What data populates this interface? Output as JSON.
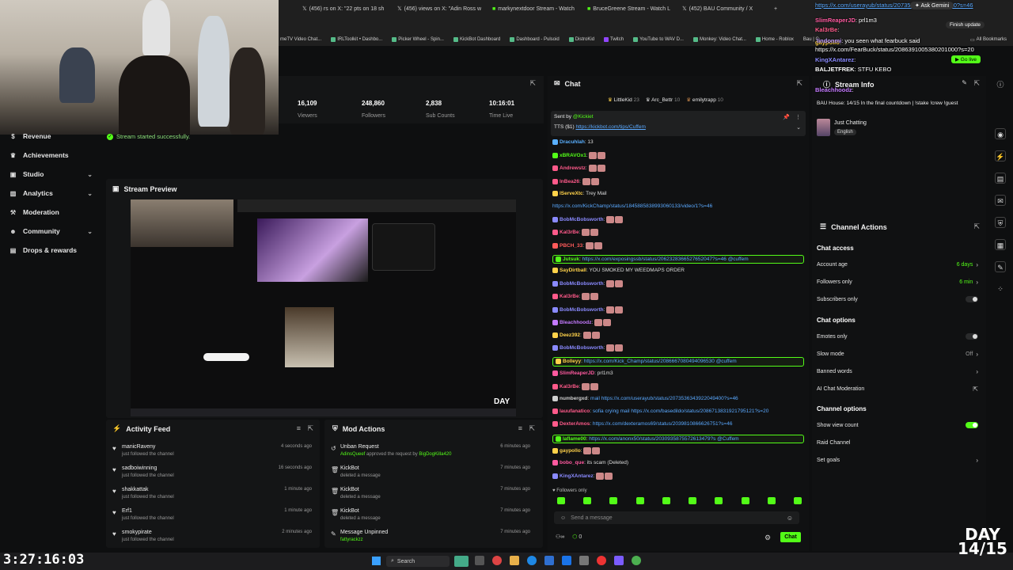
{
  "browser": {
    "tabs": [
      {
        "label": "(456) rs on X: \"22 pts on 18 sh"
      },
      {
        "label": "(456) views on X: \"Adin Ross w"
      },
      {
        "label": "markynextdoor Stream - Watch"
      },
      {
        "label": "BruceGreene Stream - Watch L"
      },
      {
        "label": "(452) BAU Community / X"
      }
    ],
    "ask_gemini": "Ask Gemini",
    "finish_update": "Finish update",
    "bookmarks": [
      "meTV Video Chat...",
      "IRLToolkit • Dashbo...",
      "Picker Wheel - Spin...",
      "KickBot Dashboard",
      "Dashboard - Pulsoid",
      "DistroKid",
      "Twitch",
      "YouTube to WAV D...",
      "Monkey: Video Chat...",
      "Home - Roblox",
      "Bau | C",
      "All Bookmarks"
    ]
  },
  "sidebar": {
    "items": [
      {
        "label": "Revenue",
        "icon": "dollar-icon",
        "chevron": false
      },
      {
        "label": "Achievements",
        "icon": "trophy-icon",
        "chevron": false
      },
      {
        "label": "Studio",
        "icon": "studio-icon",
        "chevron": true
      },
      {
        "label": "Analytics",
        "icon": "chart-icon",
        "chevron": true
      },
      {
        "label": "Moderation",
        "icon": "hammer-icon",
        "chevron": false
      },
      {
        "label": "Community",
        "icon": "people-icon",
        "chevron": true
      },
      {
        "label": "Drops & rewards",
        "icon": "gift-icon",
        "chevron": false
      }
    ]
  },
  "stats": [
    {
      "value": "16,109",
      "label": "Viewers"
    },
    {
      "value": "248,860",
      "label": "Followers"
    },
    {
      "value": "2,838",
      "label": "Sub Counts"
    },
    {
      "value": "10:16:01",
      "label": "Time Live"
    }
  ],
  "status": {
    "success": "Stream started successfully."
  },
  "preview": {
    "title": "Stream Preview",
    "day_badge": "DAY"
  },
  "activity": {
    "title": "Activity Feed",
    "items": [
      {
        "name": "manicRaveny",
        "sub": "just followed the channel",
        "time": "4 seconds ago"
      },
      {
        "name": "sadboiwinning",
        "sub": "just followed the channel",
        "time": "16 seconds ago"
      },
      {
        "name": "shakkattak",
        "sub": "just followed the channel",
        "time": "1 minute ago"
      },
      {
        "name": "Erf1",
        "sub": "just followed the channel",
        "time": "1 minute ago"
      },
      {
        "name": "smokypirate",
        "sub": "just followed the channel",
        "time": "2 minutes ago"
      }
    ]
  },
  "mod": {
    "title": "Mod Actions",
    "items": [
      {
        "name": "Unban Request",
        "sub_user": "AdinsQueef",
        "sub": "approved the request by",
        "sub_user2": "BigDogKilla420",
        "time": "6 minutes ago"
      },
      {
        "name": "KickBot",
        "sub": "deleted a message",
        "time": "7 minutes ago"
      },
      {
        "name": "KickBot",
        "sub": "deleted a message",
        "time": "7 minutes ago"
      },
      {
        "name": "KickBot",
        "sub": "deleted a message",
        "time": "7 minutes ago"
      },
      {
        "name": "Message Unpinned",
        "sub": "fattyrackzz",
        "time": "7 minutes ago"
      }
    ]
  },
  "chat": {
    "title": "Chat",
    "top_gifters": [
      {
        "name": "LittleKid",
        "count": "23"
      },
      {
        "name": "Arc_Bettr",
        "count": "10"
      },
      {
        "name": "emilytrapp",
        "count": "10"
      }
    ],
    "pinned": {
      "sent_by_label": "Sent by",
      "sent_by_user": "@Kickiet",
      "text": "TTS ($1)",
      "link": "https://kickbot.com/tips/Cuffem"
    },
    "messages": [
      {
        "user": "Dracuhlah",
        "color": "#5ab0ff",
        "text": "13"
      },
      {
        "user": "xBRAVOx1",
        "color": "#53fc18",
        "text": ""
      },
      {
        "user": "Andrewstz",
        "color": "#ff5a8a",
        "text": ""
      },
      {
        "user": "lnBea26",
        "color": "#ff5a8a",
        "text": ""
      },
      {
        "user": "lServeXtc",
        "color": "#ffd24a",
        "text": "Trey Mail"
      },
      {
        "user": "",
        "color": "#5aa9ff",
        "text": "https://x.com/KickChamp/status/1845885838993060133/video/1?s=46"
      },
      {
        "user": "BobMcBobsworth",
        "color": "#8a8aff",
        "text": ""
      },
      {
        "user": "Kal3rBe",
        "color": "#ff5a8a",
        "text": ""
      },
      {
        "user": "PBCH_33",
        "color": "#ff5a5a",
        "text": ""
      },
      {
        "user": "Jutsuk",
        "color": "#53fc18",
        "text": "https://x.com/exposingssb/status/2062328366527652047?s=46 @cuffem"
      },
      {
        "user": "SayDirtball",
        "color": "#ffd24a",
        "text": "YOU SMOKED MY WEEDMAPS ORDER"
      },
      {
        "user": "BobMcBobsworth",
        "color": "#8a8aff",
        "text": ""
      },
      {
        "user": "Kal3rBe",
        "color": "#ff5a8a",
        "text": ""
      },
      {
        "user": "BobMcBobsworth",
        "color": "#8a8aff",
        "text": ""
      },
      {
        "user": "Bleachhoodz",
        "color": "#c47aff",
        "text": ""
      },
      {
        "user": "Deez392",
        "color": "#ffd24a",
        "text": ""
      },
      {
        "user": "BobMcBobsworth",
        "color": "#8a8aff",
        "text": ""
      },
      {
        "user": "Bolleyy",
        "color": "#ffd24a",
        "text": "https://x.com/Kick_Champ/status/2086667080494096530 @cuffem"
      },
      {
        "user": "SlimReaperJD",
        "color": "#ff5aa0",
        "text": "prl1m3"
      },
      {
        "user": "Kal3rBe",
        "color": "#ff5a8a",
        "text": ""
      },
      {
        "user": "numbergxd",
        "color": "#cfcfcf",
        "text": "mail https://x.com/userayub/status/2073536343922049400?s=46"
      },
      {
        "user": "lauufanatico",
        "color": "#ff5a8a",
        "text": "sofia crying mail https://x.com/basedildo/status/2086713831921795121?s=20"
      },
      {
        "user": "DexterAmos",
        "color": "#ff5a8a",
        "text": "https://x.com/dexteramos69/status/2039810866626751?s=46"
      },
      {
        "user": "laflame00",
        "color": "#53fc18",
        "text": "https://x.com/anonx50/status/2030935875572613479?s @Cuffem"
      },
      {
        "user": "gaypollo",
        "color": "#ffd24a",
        "text": ""
      },
      {
        "user": "bobo_que",
        "color": "#ff5aa0",
        "text": "its scam (Deleted)"
      },
      {
        "user": "KingXAntarez",
        "color": "#8a8aff",
        "text": ""
      }
    ],
    "followers_only": "Followers only",
    "input_placeholder": "Send a message",
    "send_label": "Chat",
    "points": "0"
  },
  "stream_info": {
    "title": "Stream Info",
    "stream_title": "BAU House: 14/15 In the final countdown | !stake !crew !guest",
    "category": "Just Chatting",
    "language": "English"
  },
  "channel_actions": {
    "title": "Channel Actions",
    "chat_access": "Chat access",
    "account_age": {
      "label": "Account age",
      "value": "6 days"
    },
    "followers_only": {
      "label": "Followers only",
      "value": "6 min"
    },
    "subscribers_only": {
      "label": "Subscribers only"
    },
    "chat_options": "Chat options",
    "emotes_only": {
      "label": "Emotes only"
    },
    "slow_mode": {
      "label": "Slow mode",
      "value": "Off"
    },
    "banned_words": {
      "label": "Banned words"
    },
    "ai_moderation": {
      "label": "AI Chat Moderation"
    },
    "channel_options": "Channel options",
    "show_viewer_count": {
      "label": "Show view count"
    },
    "raid_channel": {
      "label": "Raid Channel"
    },
    "set_goals": {
      "label": "Set goals"
    }
  },
  "overlay_chat": [
    {
      "user": "SlimReaperJD",
      "text": "prl1m3"
    },
    {
      "user": "Kal3rBe",
      "text": ""
    },
    {
      "user": "gaypollo",
      "text": ""
    },
    {
      "user": "lindonmi",
      "text": "you seen what fearbuck said"
    },
    {
      "user": "",
      "text": "https://x.com/FearBuck/status/2086391005380201000?s=20"
    },
    {
      "user": "KingXAntarez",
      "text": ""
    },
    {
      "user": "BALJETFREK",
      "text": "STFU KEBO"
    },
    {
      "user": "Bleachhoodz",
      "text": ""
    }
  ],
  "overlay": {
    "timer": "3:27:16:03",
    "day_line1": "DAY",
    "day_line2": "14/15"
  },
  "taskbar": {
    "search": "Search"
  },
  "colors": {
    "accent": "#53fc18",
    "link": "#5aa9ff"
  }
}
